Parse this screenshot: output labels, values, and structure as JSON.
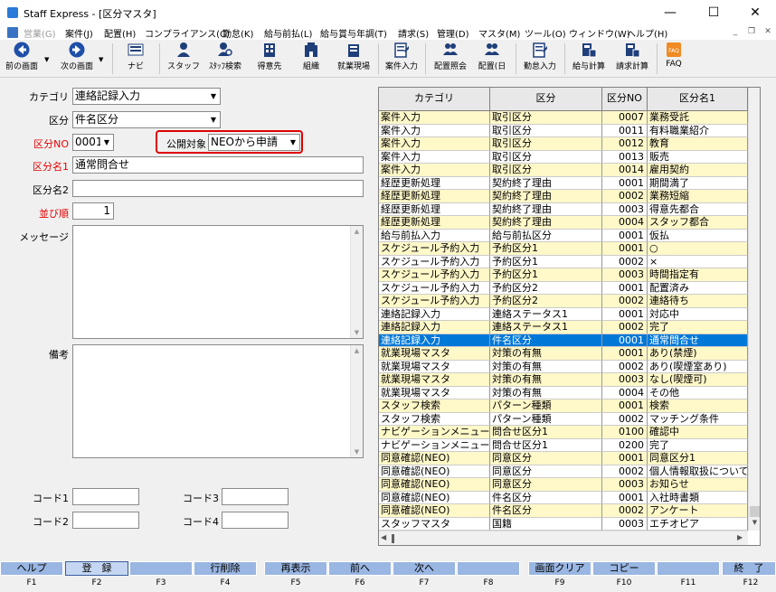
{
  "window": {
    "title": "Staff Express - [区分マスタ]",
    "minimize": "—",
    "maximize": "☐",
    "close": "✕"
  },
  "menu": [
    "営業(G)",
    "案件(J)",
    "配置(H)",
    "コンプライアンス(C)",
    "勤怠(K)",
    "給与前払(L)",
    "給与賞与年調(T)",
    "請求(S)",
    "管理(D)",
    "マスタ(M)",
    "ツール(O)",
    "ウィンドウ(W)",
    "ヘルプ(H)"
  ],
  "toolbar": [
    {
      "label": "前の画面",
      "icon": "back-arrow-icon"
    },
    {
      "label": "次の画面",
      "icon": "forward-arrow-icon"
    },
    {
      "label": "ナビ",
      "icon": "navi-icon"
    },
    {
      "label": "スタッフ",
      "icon": "staff-icon"
    },
    {
      "label": "ｽﾀｯﾌ検索",
      "icon": "staff-search-icon"
    },
    {
      "label": "得意先",
      "icon": "customer-icon"
    },
    {
      "label": "組織",
      "icon": "organization-icon"
    },
    {
      "label": "就業現場",
      "icon": "worksite-icon"
    },
    {
      "label": "案件入力",
      "icon": "case-input-icon"
    },
    {
      "label": "配置照会",
      "icon": "placement-inquiry-icon"
    },
    {
      "label": "配置(日",
      "icon": "placement-daily-icon"
    },
    {
      "label": "勤怠入力",
      "icon": "attendance-input-icon"
    },
    {
      "label": "給与計算",
      "icon": "payroll-icon"
    },
    {
      "label": "請求計算",
      "icon": "billing-icon"
    },
    {
      "label": "FAQ",
      "icon": "faq-icon"
    }
  ],
  "form": {
    "category_label": "カテゴリ",
    "category_value": "連絡記録入力",
    "kubun_label": "区分",
    "kubun_value": "件名区分",
    "kubun_no_label": "区分NO",
    "kubun_no_value": "0001",
    "public_label": "公開対象",
    "public_value": "NEOから申請",
    "name1_label": "区分名1",
    "name1_value": "通常問合せ",
    "name2_label": "区分名2",
    "name2_value": "",
    "order_label": "並び順",
    "order_value": "1",
    "message_label": "メッセージ",
    "remarks_label": "備考",
    "code1_label": "コード1",
    "code2_label": "コード2",
    "code3_label": "コード3",
    "code4_label": "コード4"
  },
  "grid": {
    "headers": [
      "カテゴリ",
      "区分",
      "区分NO",
      "区分名1"
    ],
    "rows": [
      [
        "案件入力",
        "取引区分",
        "0007",
        "業務受託",
        "y"
      ],
      [
        "案件入力",
        "取引区分",
        "0011",
        "有料職業紹介",
        "w"
      ],
      [
        "案件入力",
        "取引区分",
        "0012",
        "教育",
        "y"
      ],
      [
        "案件入力",
        "取引区分",
        "0013",
        "販売",
        "w"
      ],
      [
        "案件入力",
        "取引区分",
        "0014",
        "雇用契約",
        "y"
      ],
      [
        "経歴更新処理",
        "契約終了理由",
        "0001",
        "期間満了",
        "w"
      ],
      [
        "経歴更新処理",
        "契約終了理由",
        "0002",
        "業務短縮",
        "y"
      ],
      [
        "経歴更新処理",
        "契約終了理由",
        "0003",
        "得意先都合",
        "w"
      ],
      [
        "経歴更新処理",
        "契約終了理由",
        "0004",
        "スタッフ都合",
        "y"
      ],
      [
        "給与前払入力",
        "給与前払区分",
        "0001",
        "仮払",
        "w"
      ],
      [
        "スケジュール予約入力",
        "予約区分1",
        "0001",
        "○",
        "y"
      ],
      [
        "スケジュール予約入力",
        "予約区分1",
        "0002",
        "×",
        "w"
      ],
      [
        "スケジュール予約入力",
        "予約区分1",
        "0003",
        "時間指定有",
        "y"
      ],
      [
        "スケジュール予約入力",
        "予約区分2",
        "0001",
        "配置済み",
        "w"
      ],
      [
        "スケジュール予約入力",
        "予約区分2",
        "0002",
        "連絡待ち",
        "y"
      ],
      [
        "連絡記録入力",
        "連絡ステータス1",
        "0001",
        "対応中",
        "w"
      ],
      [
        "連絡記録入力",
        "連絡ステータス1",
        "0002",
        "完了",
        "y"
      ],
      [
        "連絡記録入力",
        "件名区分",
        "0001",
        "通常問合せ",
        "s"
      ],
      [
        "就業現場マスタ",
        "対策の有無",
        "0001",
        "あり(禁煙)",
        "y"
      ],
      [
        "就業現場マスタ",
        "対策の有無",
        "0002",
        "あり(喫煙室あり)",
        "w"
      ],
      [
        "就業現場マスタ",
        "対策の有無",
        "0003",
        "なし(喫煙可)",
        "y"
      ],
      [
        "就業現場マスタ",
        "対策の有無",
        "0004",
        "その他",
        "w"
      ],
      [
        "スタッフ検索",
        "パターン種類",
        "0001",
        "検索",
        "y"
      ],
      [
        "スタッフ検索",
        "パターン種類",
        "0002",
        "マッチング条件",
        "w"
      ],
      [
        "ナビゲーションメニュー",
        "問合せ区分1",
        "0100",
        "確認中",
        "y"
      ],
      [
        "ナビゲーションメニュー",
        "問合せ区分1",
        "0200",
        "完了",
        "w"
      ],
      [
        "同意確認(NEO)",
        "同意区分",
        "0001",
        "同意区分1",
        "y"
      ],
      [
        "同意確認(NEO)",
        "同意区分",
        "0002",
        "個人情報取扱について",
        "w"
      ],
      [
        "同意確認(NEO)",
        "同意区分",
        "0003",
        "お知らせ",
        "y"
      ],
      [
        "同意確認(NEO)",
        "件名区分",
        "0001",
        "入社時書類",
        "w"
      ],
      [
        "同意確認(NEO)",
        "件名区分",
        "0002",
        "アンケート",
        "y"
      ],
      [
        "スタッフマスタ",
        "国籍",
        "0003",
        "エチオピア",
        "w"
      ]
    ]
  },
  "fkeys": [
    {
      "label": "ヘルプ",
      "key": "F1"
    },
    {
      "label": "登　録",
      "key": "F2"
    },
    {
      "label": "",
      "key": "F3"
    },
    {
      "label": "行削除",
      "key": "F4"
    },
    {
      "label": "再表示",
      "key": "F5"
    },
    {
      "label": "前へ",
      "key": "F6"
    },
    {
      "label": "次へ",
      "key": "F7"
    },
    {
      "label": "",
      "key": "F8"
    },
    {
      "label": "画面クリア",
      "key": "F9"
    },
    {
      "label": "コピー",
      "key": "F10"
    },
    {
      "label": "",
      "key": "F11"
    },
    {
      "label": "終　了",
      "key": "F12"
    }
  ],
  "colors": {
    "row_yellow": "#fff8c8",
    "row_white": "#ffffff",
    "selected": "#0078d7",
    "fkey": "#9ab6e2",
    "required_label": "#e60000"
  }
}
